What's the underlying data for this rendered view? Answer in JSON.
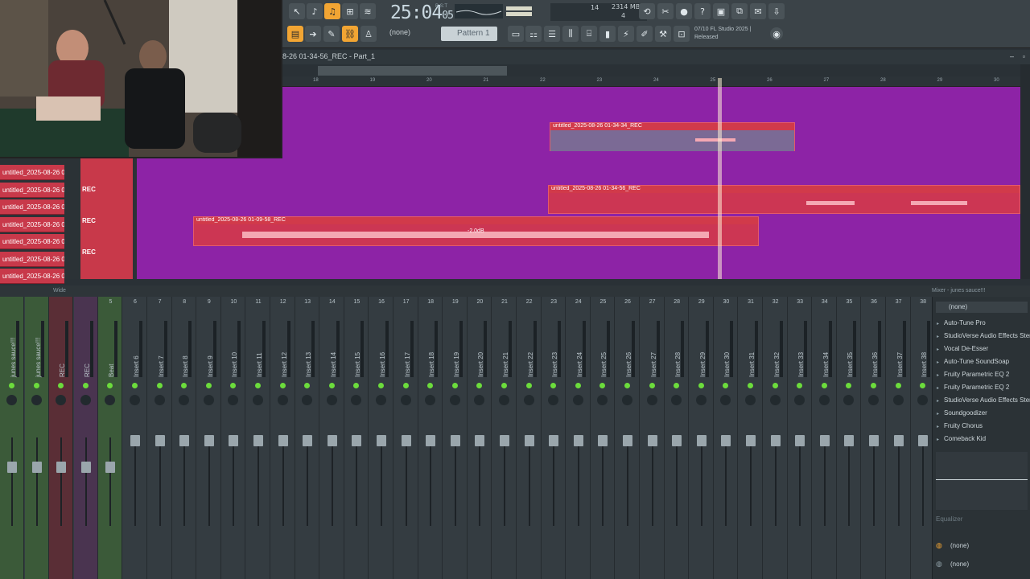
{
  "toolbar": {
    "time_main": "25:04",
    "time_sub": "05",
    "time_unit": "B:S:T",
    "cpu": "14",
    "memory": "2314 MB",
    "polyphony": "4",
    "pattern_selector": "(none)",
    "pattern_name": "Pattern 1",
    "hint_line1": "07/10  FL Studio 2025 |",
    "hint_line2": "Released",
    "accent_color": "#f2a533"
  },
  "playlist": {
    "title": "8-26 01-34-56_REC - Part_1",
    "ruler_ticks": [
      "18",
      "19",
      "20",
      "21",
      "22",
      "23",
      "24",
      "25",
      "26",
      "27",
      "28",
      "29",
      "30"
    ],
    "clips": [
      {
        "label": "untitled_2025-08-26 01-34-34_REC"
      },
      {
        "label": "untitled_2025-08-26 01-34-56_REC"
      },
      {
        "label": "untitled_2025-08-26 01-09-58_REC"
      }
    ],
    "gain_badge": "-2.0dB",
    "track_names": [
      "untitled_2025-08-26 01-",
      "untitled_2025-08-26 01-",
      "untitled_2025-08-26 01-",
      "untitled_2025-08-26 01-",
      "untitled_2025-08-26 01-",
      "untitled_2025-08-26 01-",
      "untitled_2025-08-26 01-"
    ],
    "rec_label": "REC",
    "clip_color": "#d13a4a",
    "track_bg_color": "#8d23a6"
  },
  "mixer": {
    "header_mode": "Wide",
    "title": "Mixer - junes sauce!!!",
    "strips": [
      {
        "num": "",
        "name": "junes sauce!!!"
      },
      {
        "num": "",
        "name": "junes sauce!!!"
      },
      {
        "num": "",
        "name": "REC"
      },
      {
        "num": "",
        "name": "REC"
      },
      {
        "num": "5",
        "name": "Beat"
      },
      {
        "num": "6",
        "name": "Insert 6"
      },
      {
        "num": "7",
        "name": "Insert 7"
      },
      {
        "num": "8",
        "name": "Insert 8"
      },
      {
        "num": "9",
        "name": "Insert 9"
      },
      {
        "num": "10",
        "name": "Insert 10"
      },
      {
        "num": "11",
        "name": "Insert 11"
      },
      {
        "num": "12",
        "name": "Insert 12"
      },
      {
        "num": "13",
        "name": "Insert 13"
      },
      {
        "num": "14",
        "name": "Insert 14"
      },
      {
        "num": "15",
        "name": "Insert 15"
      },
      {
        "num": "16",
        "name": "Insert 16"
      },
      {
        "num": "17",
        "name": "Insert 17"
      },
      {
        "num": "18",
        "name": "Insert 18"
      },
      {
        "num": "19",
        "name": "Insert 19"
      },
      {
        "num": "20",
        "name": "Insert 20"
      },
      {
        "num": "21",
        "name": "Insert 21"
      },
      {
        "num": "22",
        "name": "Insert 22"
      },
      {
        "num": "23",
        "name": "Insert 23"
      },
      {
        "num": "24",
        "name": "Insert 24"
      },
      {
        "num": "25",
        "name": "Insert 25"
      },
      {
        "num": "26",
        "name": "Insert 26"
      },
      {
        "num": "27",
        "name": "Insert 27"
      },
      {
        "num": "28",
        "name": "Insert 28"
      },
      {
        "num": "29",
        "name": "Insert 29"
      },
      {
        "num": "30",
        "name": "Insert 30"
      },
      {
        "num": "31",
        "name": "Insert 31"
      },
      {
        "num": "32",
        "name": "Insert 32"
      },
      {
        "num": "33",
        "name": "Insert 33"
      },
      {
        "num": "34",
        "name": "Insert 34"
      },
      {
        "num": "35",
        "name": "Insert 35"
      },
      {
        "num": "36",
        "name": "Insert 36"
      },
      {
        "num": "37",
        "name": "Insert 37"
      },
      {
        "num": "38",
        "name": "Insert 38"
      }
    ]
  },
  "fx_panel": {
    "preset_top": "(none)",
    "effects": [
      "Auto-Tune Pro",
      "StudioVerse Audio Effects Ster.",
      "Vocal De-Esser",
      "Auto-Tune SoundSoap",
      "Fruity Parametric EQ 2",
      "Fruity Parametric EQ 2",
      "StudioVerse Audio Effects Ster.",
      "Soundgoodizer",
      "Fruity Chorus",
      "Comeback Kid"
    ],
    "eq_label": "Equalizer",
    "out_1": "(none)",
    "out_2": "(none)"
  }
}
